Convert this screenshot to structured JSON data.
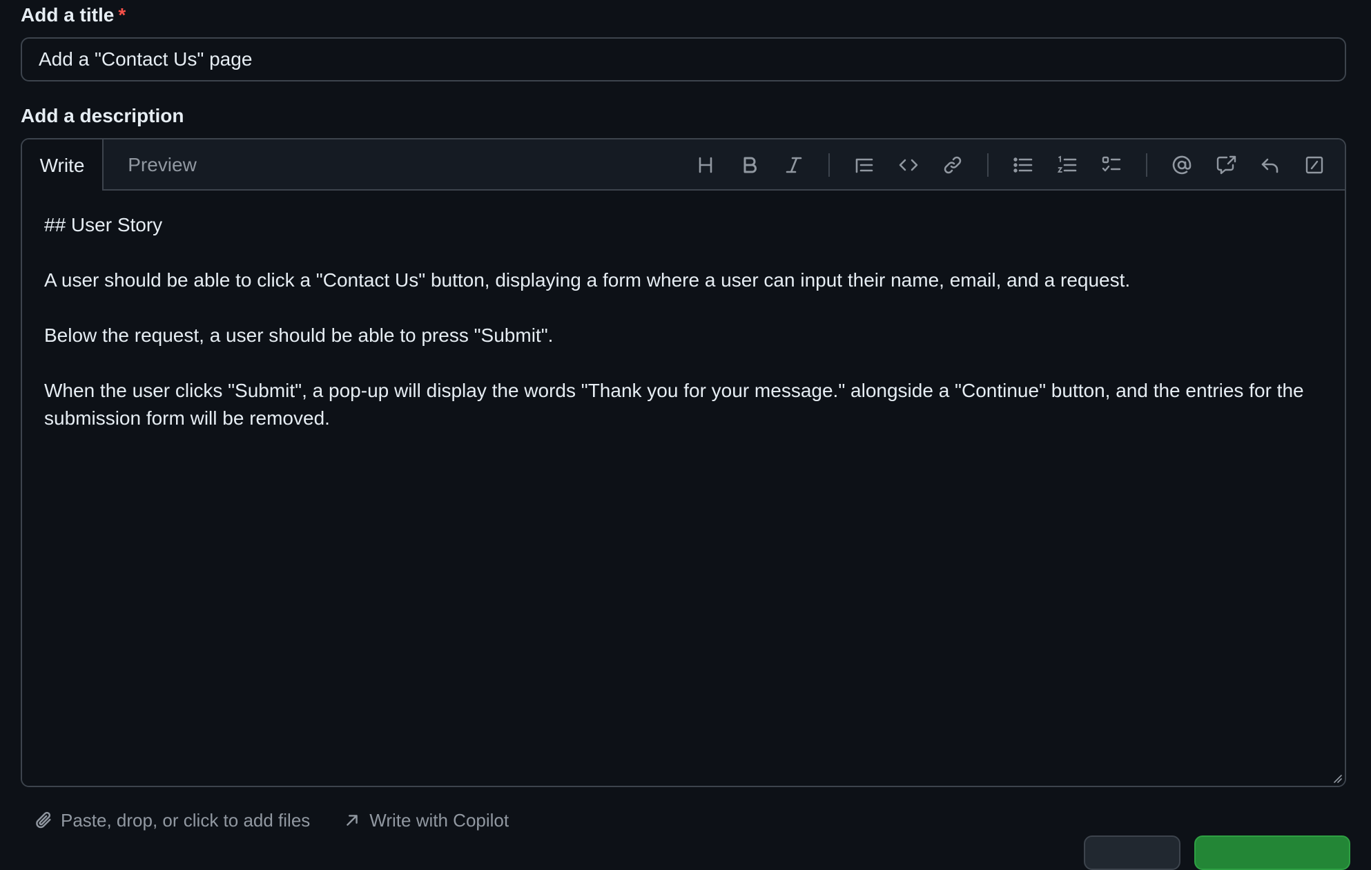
{
  "title_field": {
    "label": "Add a title",
    "required_marker": "*",
    "value": "Add a \"Contact Us\" page"
  },
  "description": {
    "label": "Add a description",
    "tabs": [
      {
        "label": "Write",
        "active": true
      },
      {
        "label": "Preview",
        "active": false
      }
    ],
    "toolbar": [
      {
        "icon": "heading-icon"
      },
      {
        "icon": "bold-icon"
      },
      {
        "icon": "italic-icon"
      },
      {
        "icon": "quote-icon"
      },
      {
        "icon": "code-icon"
      },
      {
        "icon": "link-icon"
      },
      {
        "icon": "unordered-list-icon"
      },
      {
        "icon": "ordered-list-icon"
      },
      {
        "icon": "task-list-icon"
      },
      {
        "icon": "mention-icon"
      },
      {
        "icon": "cross-reference-icon"
      },
      {
        "icon": "reply-icon"
      },
      {
        "icon": "slash-commands-icon"
      }
    ],
    "body": {
      "heading": "## User Story",
      "para1": "A user should be able to click a \"Contact Us\" button, displaying a form where a user can input their name, email, and a request.",
      "para2": "Below the request, a user should be able to press \"Submit\".",
      "para3": "When the user clicks \"Submit\", a pop-up will display the words \"Thank you for your message.\" alongside a \"Continue\" button, and the entries for the submission form will be removed."
    }
  },
  "footer": {
    "attach_label": "Paste, drop, or click to add files",
    "copilot_label": "Write with Copilot"
  },
  "colors": {
    "background": "#0d1117",
    "header_bg": "#151b23",
    "border": "#3d444d",
    "text": "#e6edf3",
    "muted": "#9198a1",
    "required": "#f85149",
    "primary_button": "#238636"
  }
}
